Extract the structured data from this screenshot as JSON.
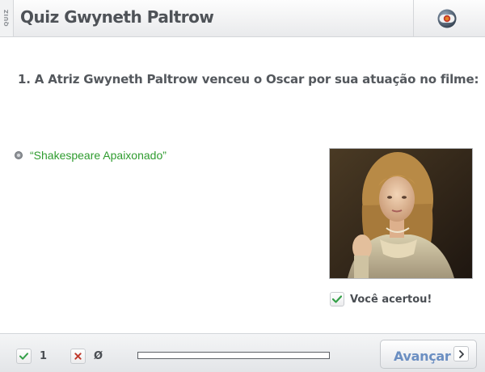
{
  "header": {
    "side_tag": "QUIZ",
    "title": "Quiz Gwyneth Paltrow",
    "logo_icon": "globo-logo-icon"
  },
  "question": {
    "text": "1. A Atriz Gwyneth Paltrow venceu o Oscar por sua atuação no filme:"
  },
  "answer": {
    "text": "“Shakespeare Apaixonado”",
    "state": "selected",
    "color": "#2f9c2f"
  },
  "photo": {
    "icon": "actress-photo"
  },
  "feedback": {
    "icon": "check-icon",
    "text": "Você acertou!"
  },
  "footer": {
    "correct": {
      "icon": "check-icon",
      "count": "1"
    },
    "wrong": {
      "icon": "x-icon",
      "count": "Ø"
    },
    "progress_fraction": 0,
    "next_button": {
      "label": "Avançar",
      "icon": "chevron-right-icon"
    }
  },
  "colors": {
    "accent_blue": "#6b8fc2",
    "correct_green": "#2f9c2f",
    "wrong_red": "#c0392b"
  }
}
